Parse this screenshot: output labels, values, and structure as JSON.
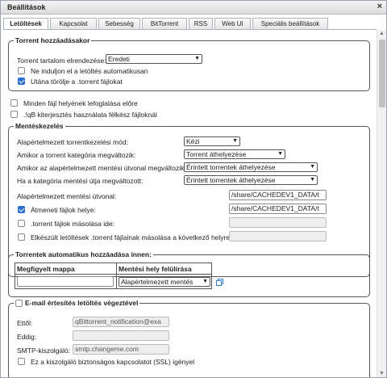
{
  "window": {
    "title": "Beállítások",
    "close_glyph": "×"
  },
  "tabs": [
    {
      "label": "Letöltések",
      "active": true
    },
    {
      "label": "Kapcsolat"
    },
    {
      "label": "Sebesség"
    },
    {
      "label": "BitTorrent"
    },
    {
      "label": "RSS"
    },
    {
      "label": "Web UI"
    },
    {
      "label": "Speciális beállítások"
    }
  ],
  "torrent_add": {
    "legend": "Torrent hozzáadásakor",
    "layout_label": "Torrent tartalom elrendezése:",
    "layout_value": "Eredeti",
    "no_autostart_label": "Ne induljon el a letöltés automatikusan",
    "no_autostart_checked": false,
    "delete_torrent_label": "Utána törölje a .torrent fájlokat",
    "delete_torrent_checked": true
  },
  "misc": {
    "preallocate_label": "Minden fájl helyének lefoglalása előre",
    "preallocate_checked": false,
    "incomplete_ext_label": ".!qB kiterjesztés használata félkész fájloknál",
    "incomplete_ext_checked": false
  },
  "saving": {
    "legend": "Mentéskezelés",
    "mode_label": "Alapértelmezett torrentkezelési mód:",
    "mode_value": "Kézi",
    "cat_changed_label": "Amikor a torrent kategória megváltozik:",
    "cat_changed_value": "Torrent áthelyezése",
    "default_path_changed_label": "Amikor az alapértelmezett mentési útvonal megváltozik:",
    "default_path_changed_value": "Érintett torrentek áthelyezése",
    "cat_path_changed_label": "Ha a kategória mentési útja megváltozott:",
    "cat_path_changed_value": "Érintett torrentek áthelyezése",
    "default_save_path_label": "Alapértelmezett mentési útvonal:",
    "default_save_path_value": "/share/CACHEDEV1_DATA/t",
    "temp_path_label": "Átmeneti fájlok helye:",
    "temp_path_checked": true,
    "temp_path_value": "/share/CACHEDEV1_DATA/t",
    "copy_torrent_label": ".torrent fájlok másolása ide:",
    "copy_torrent_checked": false,
    "copy_finished_label": "Elkészült letöltések .torrent fájlainak másolása a következő helyre:",
    "copy_finished_checked": false
  },
  "watched": {
    "legend": "Torrentek automatikus hozzáadása innen:",
    "col_folder": "Megfigyelt mappa",
    "col_override": "Mentési hely felülírása",
    "row_folder_value": "",
    "row_override_value": "Alapértelmezett mentés"
  },
  "email": {
    "legend": "E-mail értesítés letöltés végeztével",
    "checked": false,
    "from_label": "Ettől:",
    "from_value": "qBittorrent_notification@exa",
    "to_label": "Eddig:",
    "to_value": "",
    "smtp_label": "SMTP-kiszolgáló:",
    "smtp_value": "smtp.changeme.com",
    "ssl_label": "Ez a kiszolgáló biztonságos kapcsolatot (SSL) igényel"
  }
}
